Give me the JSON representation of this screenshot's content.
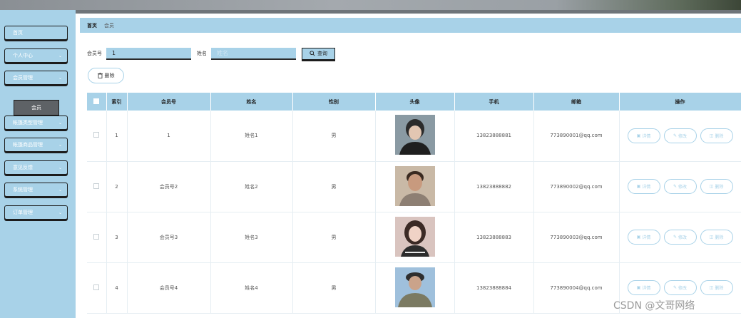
{
  "colors": {
    "accent": "#a8d2e8",
    "dark": "#1c1c1c",
    "sub_active": "#5e6266"
  },
  "sidebar": {
    "items": [
      {
        "label": "首页",
        "has_chevron": false
      },
      {
        "label": "个人中心",
        "has_chevron": true
      },
      {
        "label": "会员管理",
        "has_chevron": true
      },
      {
        "label": "帐篷类型管理",
        "has_chevron": true
      },
      {
        "label": "帐篷商品管理",
        "has_chevron": true
      },
      {
        "label": "意见反馈",
        "has_chevron": true
      },
      {
        "label": "系统管理",
        "has_chevron": true
      },
      {
        "label": "订单管理",
        "has_chevron": true
      }
    ],
    "sub_item": "会员"
  },
  "breadcrumb": {
    "home": "首页",
    "current": "会员"
  },
  "search": {
    "member_no_label": "会员号",
    "member_no_value": "1",
    "name_label": "姓名",
    "name_placeholder": "姓名",
    "button": "查询"
  },
  "actions": {
    "delete": "删除"
  },
  "table": {
    "headers": [
      "索引",
      "会员号",
      "姓名",
      "性别",
      "头像",
      "手机",
      "邮箱",
      "操作"
    ],
    "rows": [
      {
        "index": "1",
        "member_no": "1",
        "name": "姓名1",
        "gender": "男",
        "phone": "13823888881",
        "email": "773890001@qq.com"
      },
      {
        "index": "2",
        "member_no": "会员号2",
        "name": "姓名2",
        "gender": "男",
        "phone": "13823888882",
        "email": "773890002@qq.com"
      },
      {
        "index": "3",
        "member_no": "会员号3",
        "name": "姓名3",
        "gender": "男",
        "phone": "13823888883",
        "email": "773890003@qq.com"
      },
      {
        "index": "4",
        "member_no": "会员号4",
        "name": "姓名4",
        "gender": "男",
        "phone": "13823888884",
        "email": "773890004@qq.com"
      }
    ],
    "row_actions": {
      "detail": "详情",
      "edit": "修改",
      "delete": "删除"
    }
  },
  "watermark": "CSDN @文哥网络"
}
